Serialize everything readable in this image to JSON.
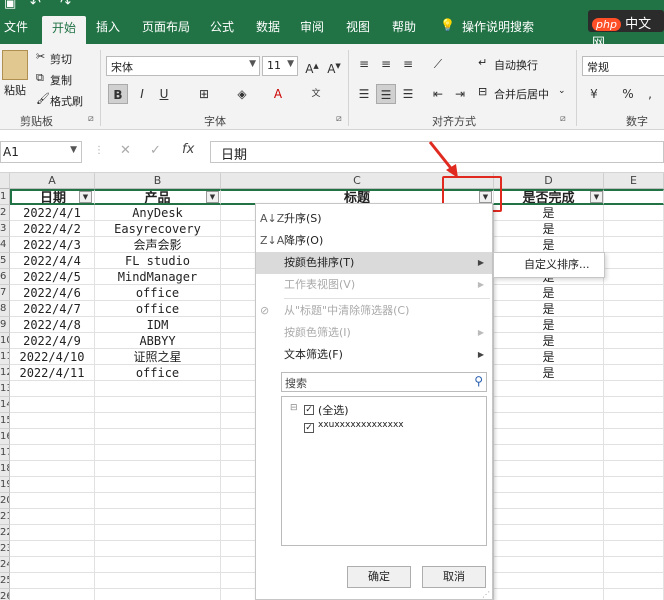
{
  "tabs": [
    "文件",
    "开始",
    "插入",
    "页面布局",
    "公式",
    "数据",
    "审阅",
    "视图",
    "帮助"
  ],
  "active_tab": "开始",
  "tell_me": "操作说明搜索",
  "watermark": {
    "php": "php",
    "site": "中文网"
  },
  "ribbon": {
    "paste": "粘贴",
    "cut": "剪切",
    "copy": "复制",
    "format_painter": "格式刷",
    "clipboard_group": "剪贴板",
    "font_name": "宋体",
    "font_size": "11",
    "font_group": "字体",
    "wrap_text": "自动换行",
    "merge_center": "合并后居中",
    "alignment_group": "对齐方式",
    "number_format": "常规",
    "number_group": "数字"
  },
  "name_box": "A1",
  "formula": "日期",
  "columns": [
    "A",
    "B",
    "C",
    "D",
    "E"
  ],
  "rows": [
    "1",
    "2",
    "3",
    "4",
    "5",
    "6",
    "7",
    "8",
    "9",
    "10",
    "11",
    "12",
    "13",
    "14",
    "15",
    "16",
    "17",
    "18",
    "19",
    "20",
    "21",
    "22",
    "23",
    "24",
    "25",
    "26"
  ],
  "headers": {
    "a": "日期",
    "b": "产品",
    "c": "标题",
    "d": "是否完成"
  },
  "data": [
    {
      "date": "2022/4/1",
      "product": "AnyDesk",
      "done": "是"
    },
    {
      "date": "2022/4/2",
      "product": "Easyrecovery",
      "done": "是"
    },
    {
      "date": "2022/4/3",
      "product": "会声会影",
      "done": "是"
    },
    {
      "date": "2022/4/4",
      "product": "FL studio",
      "done": "是"
    },
    {
      "date": "2022/4/5",
      "product": "MindManager",
      "done": "是"
    },
    {
      "date": "2022/4/6",
      "product": "office",
      "done": "是"
    },
    {
      "date": "2022/4/7",
      "product": "office",
      "done": "是"
    },
    {
      "date": "2022/4/8",
      "product": "IDM",
      "done": "是"
    },
    {
      "date": "2022/4/9",
      "product": "ABBYY",
      "done": "是"
    },
    {
      "date": "2022/4/10",
      "product": "证照之星",
      "done": "是"
    },
    {
      "date": "2022/4/11",
      "product": "office",
      "done": "是"
    }
  ],
  "filter_menu": {
    "sort_asc": "升序(S)",
    "sort_desc": "降序(O)",
    "sort_by_color": "按颜色排序(T)",
    "sheet_view": "工作表视图(V)",
    "clear_filter": "从\"标题\"中清除筛选器(C)",
    "filter_by_color": "按颜色筛选(I)",
    "text_filter": "文本筛选(F)",
    "search_placeholder": "搜索",
    "select_all": "(全选)",
    "item1": "xxuxxxxxxxxxxxxx",
    "ok": "确定",
    "cancel": "取消"
  },
  "submenu": {
    "custom_sort": "自定义排序..."
  },
  "colors": {
    "excel_green": "#217346",
    "highlight_red": "#e02a20"
  }
}
